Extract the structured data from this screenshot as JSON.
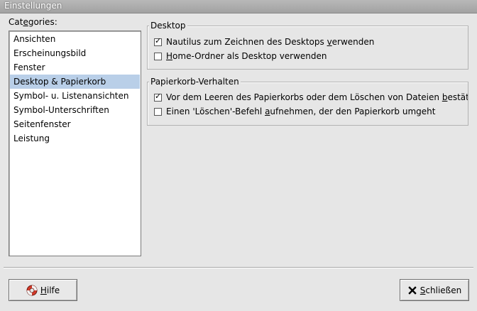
{
  "window": {
    "title": "Einstellungen"
  },
  "categories": {
    "label_pre": "Cat",
    "label_acc": "e",
    "label_post": "gories:",
    "items": [
      {
        "label": "Ansichten",
        "selected": false
      },
      {
        "label": "Erscheinungsbild",
        "selected": false
      },
      {
        "label": "Fenster",
        "selected": false
      },
      {
        "label": "Desktop & Papierkorb",
        "selected": true
      },
      {
        "label": "Symbol- u. Listenansichten",
        "selected": false
      },
      {
        "label": "Symbol-Unterschriften",
        "selected": false
      },
      {
        "label": "Seitenfenster",
        "selected": false
      },
      {
        "label": "Leistung",
        "selected": false
      }
    ]
  },
  "desktop_group": {
    "title": "Desktop",
    "options": [
      {
        "checked": true,
        "pre": "Nautilus zum Zeichnen des Desktops ",
        "acc": "v",
        "post": "erwenden"
      },
      {
        "checked": false,
        "pre": "",
        "acc": "H",
        "post": "ome-Ordner als Desktop verwenden"
      }
    ]
  },
  "trash_group": {
    "title": "Papierkorb-Verhalten",
    "options": [
      {
        "checked": true,
        "pre": "Vor dem Leeren des Papierkorbs oder dem Löschen von Dateien ",
        "acc": "b",
        "post": "estätig"
      },
      {
        "checked": false,
        "pre": "Einen 'Löschen'-Befehl ",
        "acc": "a",
        "post": "ufnehmen, der den Papierkorb umgeht"
      }
    ]
  },
  "buttons": {
    "help": {
      "acc": "H",
      "post": "ilfe"
    },
    "close": {
      "acc": "S",
      "post": "chließen"
    }
  },
  "icons": {
    "help": "lifebuoy-icon",
    "close": "close-x-icon"
  },
  "colors": {
    "selection": "#b9cfe8",
    "window_bg": "#e6e6e6"
  }
}
